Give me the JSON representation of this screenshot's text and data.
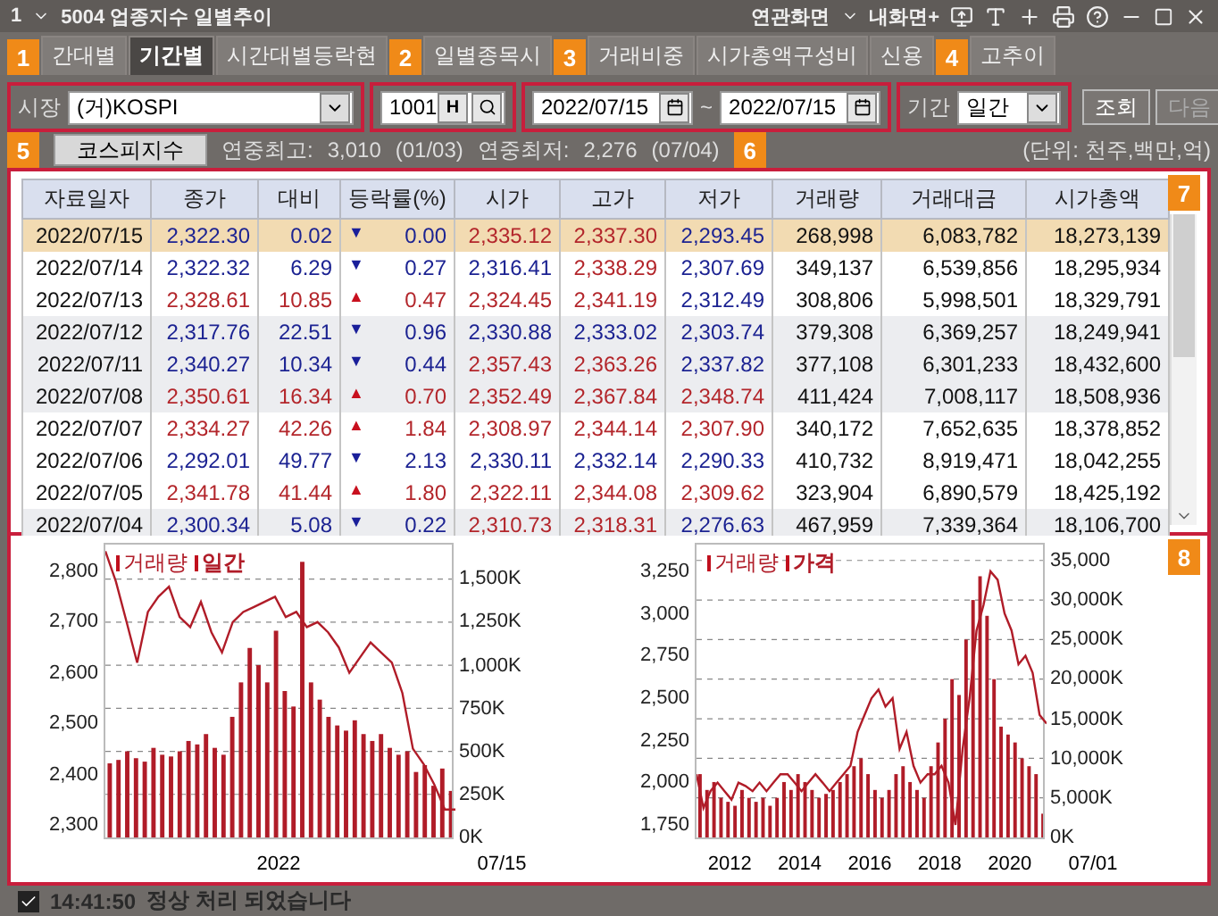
{
  "window": {
    "menu_number": "1",
    "title": "5004 업종지수 일별추이",
    "related": "연관화면",
    "my_screen": "내화면+"
  },
  "tabs": [
    {
      "label": "간대별",
      "selected": false,
      "badge": "1"
    },
    {
      "label": "기간별",
      "selected": true
    },
    {
      "label": "시간대별등락현",
      "selected": false
    },
    {
      "label": "일별종목시",
      "selected": false,
      "badge": "2"
    },
    {
      "label": "거래비중",
      "selected": false,
      "badge": "3"
    },
    {
      "label": "시가총액구성비",
      "selected": false
    },
    {
      "label": "신용",
      "selected": false
    },
    {
      "label": "고추이",
      "selected": false,
      "badge": "4"
    }
  ],
  "controls": {
    "market_label": "시장",
    "market": "(거)KOSPI",
    "code": "1001",
    "code_button": "H",
    "date_from": "2022/07/15",
    "date_sep": "~",
    "date_to": "2022/07/15",
    "period_label": "기간",
    "period": "일간",
    "search_button": "조회",
    "next_button": {
      "label": "다음",
      "disabled": true
    }
  },
  "summary": {
    "badge": "5",
    "index_button": "코스피지수",
    "high_label": "연중최고:",
    "high": "3,010",
    "high_date": "(01/03)",
    "low_label": "연중최저:",
    "low": "2,276",
    "low_date": "(07/04)",
    "unit_badge": "6",
    "unit": "(단위: 천주,백만,억)"
  },
  "table": {
    "badge": "7",
    "columns": [
      "자료일자",
      "종가",
      "대비",
      "등락률(%)",
      "시가",
      "고가",
      "저가",
      "거래량",
      "거래대금",
      "시가총액"
    ],
    "rows": [
      {
        "date": "2022/07/15",
        "close": "2,322.30",
        "change": "0.02",
        "arrow": "▼",
        "rate": "0.00",
        "up": false,
        "open": "2,335.12",
        "open_up": true,
        "high": "2,337.30",
        "high_up": true,
        "low": "2,293.45",
        "low_up": false,
        "volume": "268,998",
        "amount": "6,083,782",
        "cap": "18,273,139",
        "selected": true
      },
      {
        "date": "2022/07/14",
        "close": "2,322.32",
        "change": "6.29",
        "arrow": "▼",
        "rate": "0.27",
        "up": false,
        "open": "2,316.41",
        "open_up": false,
        "high": "2,338.29",
        "high_up": true,
        "low": "2,307.69",
        "low_up": false,
        "volume": "349,137",
        "amount": "6,539,856",
        "cap": "18,295,934",
        "selected": false
      },
      {
        "date": "2022/07/13",
        "close": "2,328.61",
        "change": "10.85",
        "arrow": "▲",
        "rate": "0.47",
        "up": true,
        "open": "2,324.45",
        "open_up": true,
        "high": "2,341.19",
        "high_up": true,
        "low": "2,312.49",
        "low_up": false,
        "volume": "308,806",
        "amount": "5,998,501",
        "cap": "18,329,791",
        "selected": false
      },
      {
        "date": "2022/07/12",
        "close": "2,317.76",
        "change": "22.51",
        "arrow": "▼",
        "rate": "0.96",
        "up": false,
        "open": "2,330.88",
        "open_up": false,
        "high": "2,333.02",
        "high_up": false,
        "low": "2,303.74",
        "low_up": false,
        "volume": "379,308",
        "amount": "6,369,257",
        "cap": "18,249,941",
        "selected": false
      },
      {
        "date": "2022/07/11",
        "close": "2,340.27",
        "change": "10.34",
        "arrow": "▼",
        "rate": "0.44",
        "up": false,
        "open": "2,357.43",
        "open_up": true,
        "high": "2,363.26",
        "high_up": true,
        "low": "2,337.82",
        "low_up": false,
        "volume": "377,108",
        "amount": "6,301,233",
        "cap": "18,432,600",
        "selected": false
      },
      {
        "date": "2022/07/08",
        "close": "2,350.61",
        "change": "16.34",
        "arrow": "▲",
        "rate": "0.70",
        "up": true,
        "open": "2,352.49",
        "open_up": true,
        "high": "2,367.84",
        "high_up": true,
        "low": "2,348.74",
        "low_up": true,
        "volume": "411,424",
        "amount": "7,008,117",
        "cap": "18,508,936",
        "selected": false
      },
      {
        "date": "2022/07/07",
        "close": "2,334.27",
        "change": "42.26",
        "arrow": "▲",
        "rate": "1.84",
        "up": true,
        "open": "2,308.97",
        "open_up": true,
        "high": "2,344.14",
        "high_up": true,
        "low": "2,307.90",
        "low_up": true,
        "volume": "340,172",
        "amount": "7,652,635",
        "cap": "18,378,852",
        "selected": false
      },
      {
        "date": "2022/07/06",
        "close": "2,292.01",
        "change": "49.77",
        "arrow": "▼",
        "rate": "2.13",
        "up": false,
        "open": "2,330.11",
        "open_up": false,
        "high": "2,332.14",
        "high_up": false,
        "low": "2,290.33",
        "low_up": false,
        "volume": "410,732",
        "amount": "8,919,471",
        "cap": "18,042,255",
        "selected": false
      },
      {
        "date": "2022/07/05",
        "close": "2,341.78",
        "change": "41.44",
        "arrow": "▲",
        "rate": "1.80",
        "up": true,
        "open": "2,322.11",
        "open_up": true,
        "high": "2,344.08",
        "high_up": true,
        "low": "2,309.62",
        "low_up": true,
        "volume": "323,904",
        "amount": "6,890,579",
        "cap": "18,425,192",
        "selected": false
      },
      {
        "date": "2022/07/04",
        "close": "2,300.34",
        "change": "5.08",
        "arrow": "▼",
        "rate": "0.22",
        "up": false,
        "open": "2,310.73",
        "open_up": true,
        "high": "2,318.31",
        "high_up": true,
        "low": "2,276.63",
        "low_up": false,
        "volume": "467,959",
        "amount": "7,339,364",
        "cap": "18,106,700",
        "selected": false
      }
    ]
  },
  "charts": {
    "badge": "8",
    "items": [
      {
        "legend": [
          {
            "bold": false
          },
          {
            "bold": true
          }
        ],
        "x_labels": [
          "2022"
        ],
        "end_label": "07/15",
        "volume": {
          "chart_data": {
            "type": "bar",
            "grid": true,
            "ylim": [
              0,
              1700
            ],
            "yticks": [
              {
                "value": 1500,
                "label": "1,500K"
              },
              {
                "value": 1250,
                "label": "1,250K"
              },
              {
                "value": 1000,
                "label": "1,000K"
              },
              {
                "value": 750,
                "label": "750K"
              },
              {
                "value": 500,
                "label": "500K"
              },
              {
                "value": 250,
                "label": "250K"
              },
              {
                "value": 0,
                "label": "0K"
              }
            ],
            "series": [
              {
                "name": "거래량",
                "color": "#b01c28",
                "values": [
                  430,
                  450,
                  500,
                  460,
                  440,
                  520,
                  480,
                  470,
                  500,
                  560,
                  540,
                  600,
                  520,
                  480,
                  700,
                  900,
                  1100,
                  1000,
                  900,
                  1200,
                  850,
                  760,
                  1600,
                  900,
                  800,
                  700,
                  650,
                  620,
                  680,
                  600,
                  560,
                  600,
                  520,
                  480,
                  500,
                  380,
                  420,
                  300,
                  400,
                  270
                ]
              }
            ]
          }
        },
        "price": {
          "chart_data": {
            "type": "line",
            "ylim": [
              2275,
              2853
            ],
            "yticks": [
              {
                "value": 2800,
                "label": "2,800"
              },
              {
                "value": 2700,
                "label": "2,700"
              },
              {
                "value": 2600,
                "label": "2,600"
              },
              {
                "value": 2500,
                "label": "2,500"
              },
              {
                "value": 2400,
                "label": "2,400"
              },
              {
                "value": 2300,
                "label": "2,300"
              }
            ],
            "series": [
              {
                "name": "일간",
                "color": "#b01c28",
                "values": [
                  2840,
                  2780,
                  2700,
                  2620,
                  2720,
                  2750,
                  2770,
                  2710,
                  2690,
                  2740,
                  2680,
                  2640,
                  2700,
                  2720,
                  2730,
                  2740,
                  2750,
                  2710,
                  2720,
                  2690,
                  2700,
                  2680,
                  2650,
                  2600,
                  2630,
                  2660,
                  2640,
                  2620,
                  2560,
                  2450,
                  2420,
                  2380,
                  2330,
                  2330
                ]
              }
            ]
          }
        }
      },
      {
        "legend": [
          {
            "bold": false
          },
          {
            "bold": true
          }
        ],
        "x_labels": [
          "2012",
          "2014",
          "2016",
          "2018",
          "2020"
        ],
        "end_label": "07/01",
        "volume": {
          "chart_data": {
            "type": "bar",
            "grid": true,
            "ylim": [
              0,
              37000
            ],
            "yticks": [
              {
                "value": 35000,
                "label": "35,000"
              },
              {
                "value": 30000,
                "label": "30,000K"
              },
              {
                "value": 25000,
                "label": "25,000K"
              },
              {
                "value": 20000,
                "label": "20,000K"
              },
              {
                "value": 15000,
                "label": "15,000K"
              },
              {
                "value": 10000,
                "label": "10,000K"
              },
              {
                "value": 5000,
                "label": "5,000K"
              },
              {
                "value": 0,
                "label": "0K"
              }
            ],
            "series": [
              {
                "name": "거래량",
                "color": "#b01c28",
                "values": [
                  8000,
                  6000,
                  7000,
                  5000,
                  4500,
                  4000,
                  6000,
                  5000,
                  4500,
                  5000,
                  4000,
                  5000,
                  7000,
                  6000,
                  8000,
                  7000,
                  6000,
                  5000,
                  5500,
                  6000,
                  7000,
                  8000,
                  9000,
                  10000,
                  8000,
                  6000,
                  5000,
                  6000,
                  8000,
                  9000,
                  7000,
                  6000,
                  5000,
                  9000,
                  12000,
                  15000,
                  20000,
                  18000,
                  25000,
                  30000,
                  33000,
                  28000,
                  20000,
                  14000,
                  13000,
                  12000,
                  10000,
                  9000,
                  8000,
                  3000
                ]
              }
            ]
          }
        },
        "price": {
          "chart_data": {
            "type": "line",
            "ylim": [
              1676,
              3408
            ],
            "yticks": [
              {
                "value": 3250,
                "label": "3,250"
              },
              {
                "value": 3000,
                "label": "3,000"
              },
              {
                "value": 2750,
                "label": "2,750"
              },
              {
                "value": 2500,
                "label": "2,500"
              },
              {
                "value": 2250,
                "label": "2,250"
              },
              {
                "value": 2000,
                "label": "2,000"
              },
              {
                "value": 1750,
                "label": "1,750"
              }
            ],
            "series": [
              {
                "name": "가격",
                "color": "#b01c28",
                "values": [
                  2050,
                  1850,
                  1950,
                  2000,
                  1950,
                  1900,
                  2000,
                  1980,
                  1950,
                  2000,
                  1950,
                  2000,
                  2050,
                  2050,
                  2000,
                  1950,
                  2000,
                  2050,
                  2000,
                  1950,
                  2000,
                  2050,
                  2100,
                  2300,
                  2400,
                  2500,
                  2550,
                  2450,
                  2500,
                  2200,
                  2300,
                  2100,
                  2000,
                  2050,
                  2050,
                  2100,
                  2000,
                  1750,
                  2200,
                  2500,
                  2900,
                  3050,
                  3250,
                  3200,
                  3000,
                  2900,
                  2700,
                  2750,
                  2650,
                  2400,
                  2350
                ]
              }
            ]
          }
        }
      }
    ]
  },
  "status": {
    "checked": true,
    "time": "14:41:50",
    "message": "정상 처리 되었습니다"
  }
}
